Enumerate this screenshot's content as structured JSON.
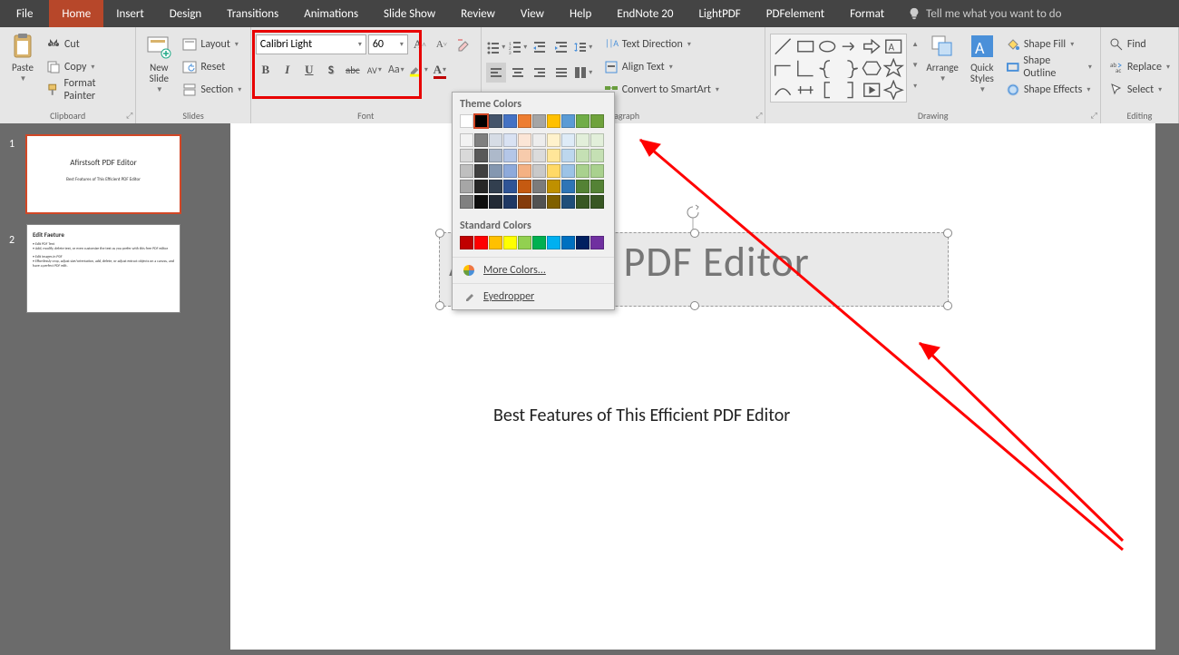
{
  "menu": {
    "file": "File",
    "home": "Home",
    "insert": "Insert",
    "design": "Design",
    "transitions": "Transitions",
    "animations": "Animations",
    "slideshow": "Slide Show",
    "review": "Review",
    "view": "View",
    "help": "Help",
    "endnote": "EndNote 20",
    "lightpdf": "LightPDF",
    "pdfelement": "PDFelement",
    "format": "Format",
    "tellme": "Tell me what you want to do"
  },
  "ribbon": {
    "clipboard": {
      "label": "Clipboard",
      "paste": "Paste",
      "cut": "Cut",
      "copy": "Copy",
      "formatpainter": "Format Painter"
    },
    "slides": {
      "label": "Slides",
      "newslide": "New\nSlide",
      "layout": "Layout",
      "reset": "Reset",
      "section": "Section"
    },
    "font": {
      "label": "Font",
      "name": "Calibri Light",
      "size": "60"
    },
    "paragraph": {
      "label": "aragraph",
      "textdir": "Text Direction",
      "align": "Align Text",
      "smartart": "Convert to SmartArt"
    },
    "drawing": {
      "label": "Drawing",
      "arrange": "Arrange",
      "quick": "Quick\nStyles",
      "fill": "Shape Fill",
      "outline": "Shape Outline",
      "effects": "Shape Effects"
    },
    "editing": {
      "label": "Editing",
      "find": "Find",
      "replace": "Replace",
      "select": "Select"
    }
  },
  "colorpopup": {
    "theme": "Theme Colors",
    "standard": "Standard Colors",
    "more": "More Colors...",
    "eyedrop": "Eyedropper"
  },
  "slide": {
    "title": "Afirstsoft PDF Editor",
    "subtitle": "Best Features of This Efficient PDF Editor"
  },
  "thumbs": {
    "s1": {
      "num": "1",
      "title": "Afirstsoft PDF Editor",
      "sub": "Best Features of This Efficient PDF Editor"
    },
    "s2": {
      "num": "2",
      "title": "Edit Faeture",
      "b1": "• Edit PDF Text",
      "b2": "• Add, modify, delete text, or even customize the text as you prefer with this free PDF editor",
      "b3": "• Edit Images in PDF",
      "b4": "• Effortlessly crop, adjust size/orientation, add, delete, or adjust extract objects on a canvas, and have a perfect PDF edit."
    }
  },
  "theme_colors": [
    [
      "#ffffff",
      "#000000",
      "#44546a",
      "#4472c4",
      "#ed7d31",
      "#a5a5a5",
      "#ffc000",
      "#5b9bd5",
      "#70ad47",
      "#6fa23c"
    ],
    [
      "#f2f2f2",
      "#7f7f7f",
      "#d6dce5",
      "#d9e2f3",
      "#fbe5d6",
      "#ededed",
      "#fff2cc",
      "#deebf7",
      "#e2efda",
      "#e2efda"
    ],
    [
      "#d9d9d9",
      "#595959",
      "#adb9ca",
      "#b4c6e7",
      "#f7cbac",
      "#dbdbdb",
      "#ffe699",
      "#bdd7ee",
      "#c5e0b4",
      "#c5e0b4"
    ],
    [
      "#bfbfbf",
      "#404040",
      "#8497b0",
      "#8eaadb",
      "#f4b183",
      "#c9c9c9",
      "#ffd966",
      "#9cc3e6",
      "#a9d18e",
      "#a9d18e"
    ],
    [
      "#a6a6a6",
      "#262626",
      "#323f4f",
      "#2f5496",
      "#c55a11",
      "#7b7b7b",
      "#bf9000",
      "#2e75b6",
      "#548235",
      "#548235"
    ],
    [
      "#808080",
      "#0d0d0d",
      "#222a35",
      "#1f3864",
      "#843c0c",
      "#525252",
      "#806000",
      "#1f4e79",
      "#385723",
      "#385723"
    ]
  ],
  "standard_colors": [
    "#c00000",
    "#ff0000",
    "#ffc000",
    "#ffff00",
    "#92d050",
    "#00b050",
    "#00b0f0",
    "#0070c0",
    "#002060",
    "#7030a0"
  ]
}
